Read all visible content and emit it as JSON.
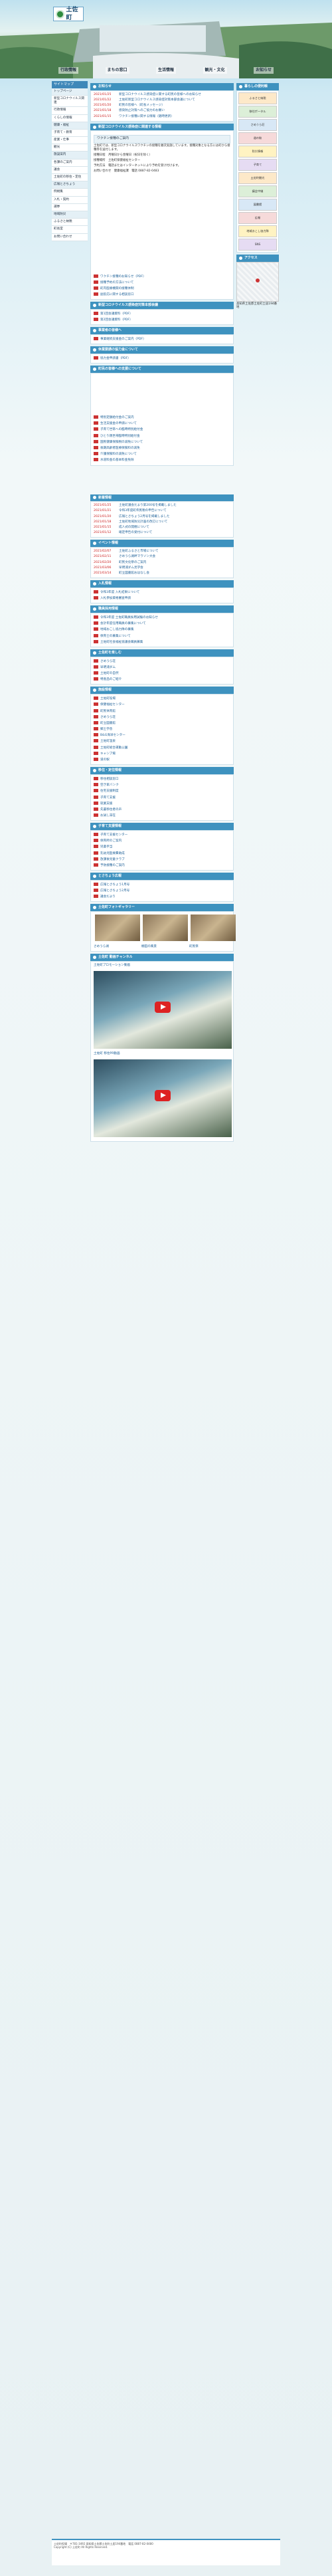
{
  "site": {
    "name": "土佐町",
    "nav": [
      "行政情報",
      "まちの窓口",
      "生活情報",
      "観光・文化",
      "お知らせ"
    ]
  },
  "left_nav": {
    "head": "サイトマップ",
    "items": [
      "トップページ",
      "新型コロナウイルス関連",
      "行政情報",
      "くらしの情報",
      "健康・福祉",
      "子育て・教育",
      "産業・仕事",
      "観光",
      "施設案内",
      "各課のご案内",
      "議会",
      "土佐町の移住・定住",
      "広報とさちょう",
      "例規集",
      "入札・契約",
      "選挙",
      "地域防災",
      "ふるさと納税",
      "町長室",
      "お問い合わせ"
    ]
  },
  "main": {
    "notice_title": "お知らせ",
    "notices": [
      {
        "d": "2021/01/25",
        "t": "新型コロナウイルス感染症に関する町民の皆様へのお知らせ"
      },
      {
        "d": "2021/01/22",
        "t": "土佐町新型コロナウイルス感染症対策本部会議について"
      },
      {
        "d": "2021/01/20",
        "t": "町民の皆様へ（町長メッセージ）"
      },
      {
        "d": "2021/01/18",
        "t": "感染防止対策へのご協力のお願い"
      },
      {
        "d": "2021/01/15",
        "t": "ワクチン接種に関する情報（随時更新）"
      }
    ],
    "covid_title": "新型コロナウイルス感染症に関連する情報",
    "covid_head": "ワクチン接種のご案内",
    "covid_paras": [
      "土佐町では、新型コロナウイルスワクチンの接種を順次実施しています。接種対象となる方には町から接種券を送付します。",
      "接種日程　月曜日から金曜日（祝日を除く）",
      "接種場所　土佐町保健福祉センター",
      "予約方法　電話またはインターネットにより予約を受け付けます。",
      "お問い合わせ　健康福祉課　電話 0887-82-0483"
    ],
    "covid_links": [
      "ワクチン接種のお知らせ（PDF）",
      "接種予約の方法について",
      "町内医療機関の接種体制",
      "副反応に関する相談窓口"
    ],
    "sections": [
      {
        "title": "新型コロナウイルス感染症対策本部会議",
        "links": [
          "第1回会議資料（PDF）",
          "第2回会議資料（PDF）"
        ]
      },
      {
        "title": "事業者の皆様へ",
        "links": [
          "事業継続支援金のご案内（PDF）"
        ]
      },
      {
        "title": "休業要請の協力金について",
        "links": [
          "協力金申請書（PDF）"
        ]
      },
      {
        "title": "町民の皆様への支援について",
        "links": [
          "特別定額給付金のご案内",
          "生活支援金の申請について",
          "子育て世帯への臨時特別給付金",
          "ひとり親世帯臨時特別給付金",
          "国民健康保険税の減免について",
          "後期高齢者医療保険料の減免",
          "介護保険料の減免について",
          "水道料金の基本料金免除"
        ]
      }
    ],
    "news_title": "新着情報",
    "news": [
      {
        "d": "2021/01/25",
        "t": "土佐町議会だより第200号を掲載しました"
      },
      {
        "d": "2021/01/21",
        "t": "令和3年度町県民税の申告について"
      },
      {
        "d": "2021/01/20",
        "t": "広報とさちょう2月号を掲載しました"
      },
      {
        "d": "2021/01/18",
        "t": "土佐町地域防災計画の改訂について"
      },
      {
        "d": "2021/01/15",
        "t": "成人式の開催について"
      },
      {
        "d": "2021/01/12",
        "t": "確定申告の受付について"
      }
    ],
    "event_title": "イベント情報",
    "events": [
      {
        "d": "2021/02/07",
        "t": "土佐町ふるさと市場について"
      },
      {
        "d": "2021/02/11",
        "t": "さめうら湖畔マラソン大会"
      },
      {
        "d": "2021/02/20",
        "t": "町民文化祭のご案内"
      },
      {
        "d": "2021/03/06",
        "t": "早明浦ダム見学会"
      },
      {
        "d": "2021/03/14",
        "t": "町立図書館おはなし会"
      }
    ],
    "bid_title": "入札情報",
    "bids": [
      "令和3年度 入札結果について",
      "入札参加資格審査申請"
    ],
    "recruit_title": "職員採用情報",
    "recruits": [
      "令和3年度 土佐町職員採用試験のお知らせ",
      "会計年度任用職員の募集について",
      "地域おこし協力隊の募集",
      "保育士の募集について",
      "土佐町社会福祉協議会職員募集"
    ],
    "tour_title": "土佐町を楽しむ",
    "tour_links": [
      "さめうら荘",
      "早明浦ダム",
      "土佐町の自然",
      "特産品のご紹介"
    ],
    "facility_title": "施設情報",
    "facilities": [
      "土佐町役場",
      "保健福祉センター",
      "町民体育館",
      "さめうら荘",
      "町立図書館",
      "郷土学舎",
      "B&G海洋センター",
      "土佐町温泉",
      "土佐町総合運動公園",
      "キャンプ場",
      "道の駅"
    ],
    "emigrate_title": "移住・定住情報",
    "emigrate": [
      "移住相談窓口",
      "空き家バンク",
      "住宅支援制度",
      "子育て支援",
      "就業支援",
      "先輩移住者の声",
      "お試し滞在"
    ],
    "child_title": "子育て支援情報",
    "child_links": [
      "子育て支援センター",
      "保育所のご案内",
      "児童手当",
      "乳幼児医療費助成",
      "放課後児童クラブ",
      "予防接種のご案内"
    ],
    "pr_title": "とさちょう広報",
    "pr": [
      "広報とさちょう1月号",
      "広報とさちょう2月号",
      "議会だより"
    ],
    "photo_title": "土佐町フォトギャラリー",
    "photo_caps": [
      "さめうら湖",
      "棚田の風景",
      "町民祭"
    ],
    "video_title": "土佐町 動画チャンネル",
    "video_caps": [
      "土佐町プロモーション動画",
      "土佐町 移住PR動画"
    ]
  },
  "right": {
    "title": "暮らしの便利帳",
    "banners": [
      "ふるさと納税",
      "移住ポータル",
      "さめうら荘",
      "道の駅",
      "防災情報",
      "子育て",
      "土佐町観光",
      "議会中継",
      "図書館",
      "広報",
      "地域おこし協力隊",
      "SNS"
    ],
    "map_title": "アクセス",
    "address": "高知県土佐郡土佐町土居194番地"
  },
  "footer": {
    "text": "土佐町役場　〒781-3492 高知県土佐郡土佐町土居194番地　電話 0887-82-0480",
    "copy": "Copyright (C) 土佐町 All Rights Reserved."
  }
}
